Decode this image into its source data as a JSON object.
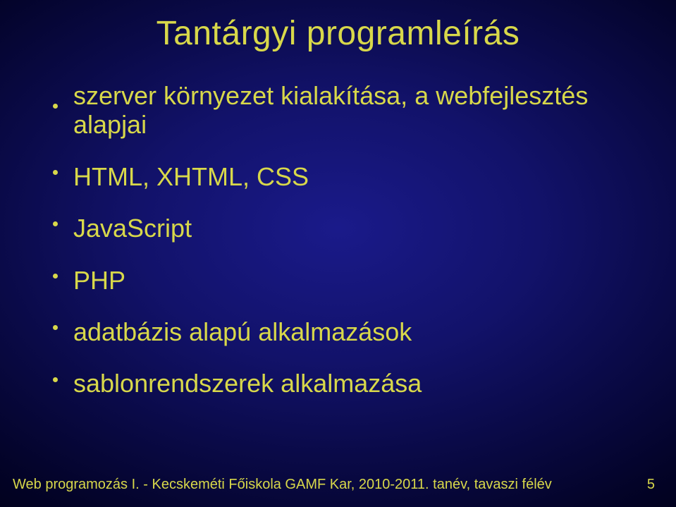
{
  "slide": {
    "title": "Tantárgyi programleírás",
    "bullets": [
      "szerver környezet kialakítása, a webfejlesztés alapjai",
      "HTML, XHTML, CSS",
      "JavaScript",
      "PHP",
      "adatbázis alapú alkalmazások",
      "sablonrendszerek alkalmazása"
    ],
    "footer": {
      "text": "Web programozás I. - Kecskeméti Főiskola GAMF Kar, 2010-2011. tanév, tavaszi félév",
      "page": "5"
    }
  }
}
